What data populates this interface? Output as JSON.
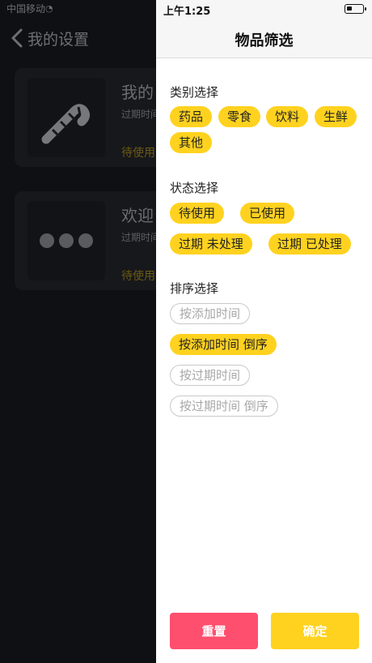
{
  "background": {
    "status_left": "中国移动",
    "nav_title": "我的设置",
    "cards": [
      {
        "title": "我的",
        "subtitle": "过期时间",
        "tag": "待使用"
      },
      {
        "title": "欢迎",
        "subtitle": "过期时间",
        "tag": "待使用"
      }
    ]
  },
  "drawer": {
    "status_time": "上午1:25",
    "title": "物品筛选",
    "category": {
      "title": "类别选择",
      "options": [
        "药品",
        "零食",
        "饮料",
        "生鲜",
        "其他"
      ]
    },
    "status": {
      "title": "状态选择",
      "options": [
        "待使用",
        "已使用",
        "过期 未处理",
        "过期 已处理"
      ]
    },
    "sort": {
      "title": "排序选择",
      "options": [
        "按添加时间",
        "按添加时间 倒序",
        "按过期时间",
        "按过期时间 倒序"
      ]
    },
    "reset_label": "重置",
    "confirm_label": "确定"
  },
  "colors": {
    "accent": "#ffd21f",
    "reset": "#ff4f6e",
    "overlay": "#0f1013"
  },
  "icons": [
    "back-chevron-icon",
    "candy-cane-icon",
    "more-dots-icon",
    "battery-icon",
    "wifi-icon"
  ]
}
